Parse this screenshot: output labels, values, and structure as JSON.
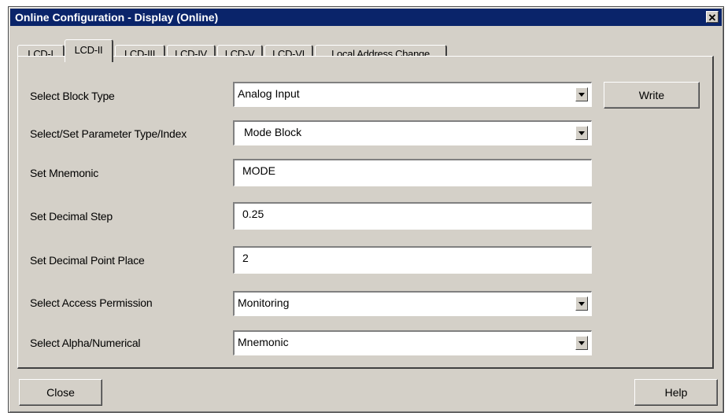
{
  "window": {
    "title": "Online Configuration - Display  (Online)",
    "close_glyph": "✕"
  },
  "tabs": [
    {
      "label": "LCD-I",
      "active": false
    },
    {
      "label": "LCD-II",
      "active": true
    },
    {
      "label": "LCD-III",
      "active": false
    },
    {
      "label": "LCD-IV",
      "active": false
    },
    {
      "label": "LCD-V",
      "active": false
    },
    {
      "label": "LCD-VI",
      "active": false
    },
    {
      "label": "Local Address Change",
      "active": false
    }
  ],
  "form": {
    "block_type": {
      "label": "Select Block Type",
      "value": "Analog Input"
    },
    "parameter": {
      "label": "Select/Set Parameter Type/Index",
      "value": "Mode Block"
    },
    "mnemonic": {
      "label": "Set Mnemonic",
      "value": "MODE"
    },
    "decimal_step": {
      "label": "Set Decimal Step",
      "value": "0.25"
    },
    "decimal_point": {
      "label": "Set Decimal Point Place",
      "value": "2"
    },
    "access": {
      "label": "Select Access Permission",
      "value": "Monitoring"
    },
    "alpha_num": {
      "label": "Select Alpha/Numerical",
      "value": "Mnemonic"
    }
  },
  "buttons": {
    "write": "Write",
    "close": "Close",
    "help": "Help"
  },
  "icons": {
    "close": "close-icon",
    "dropdown": "chevron-down-icon"
  }
}
